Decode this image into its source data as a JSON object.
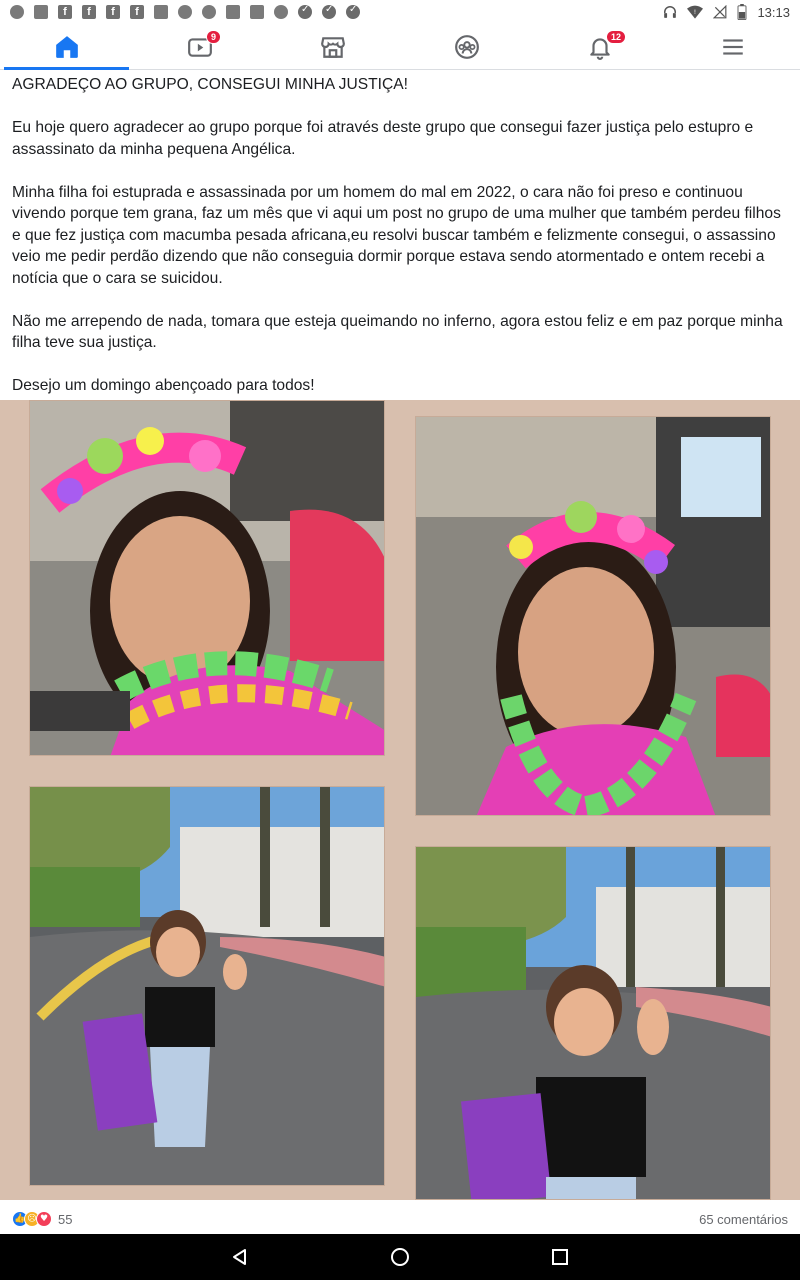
{
  "status_bar": {
    "time": "13:13",
    "left_icons": [
      "whatsapp-business-icon",
      "notification-icon",
      "facebook-icon",
      "facebook-icon",
      "facebook-icon",
      "facebook-icon",
      "instagram-icon",
      "circle-icon",
      "whatsapp-icon",
      "instagram-icon",
      "image-icon",
      "whatsapp-business-icon",
      "check-icon",
      "check-icon",
      "check-icon"
    ],
    "right_icons": [
      "headphones-icon",
      "wifi-icon",
      "no-signal-icon",
      "battery-icon"
    ]
  },
  "nav": {
    "tabs": [
      {
        "name": "home",
        "icon": "home-icon",
        "badge": ""
      },
      {
        "name": "watch",
        "icon": "video-icon",
        "badge": "9"
      },
      {
        "name": "marketplace",
        "icon": "store-icon",
        "badge": ""
      },
      {
        "name": "groups",
        "icon": "groups-icon",
        "badge": ""
      },
      {
        "name": "notifications",
        "icon": "bell-icon",
        "badge": "12"
      },
      {
        "name": "menu",
        "icon": "menu-icon",
        "badge": ""
      }
    ],
    "accent_color": "#1877f2"
  },
  "post": {
    "paragraphs": [
      "AGRADEÇO AO GRUPO, CONSEGUI MINHA JUSTIÇA!",
      "Eu hoje quero agradecer ao grupo porque foi através deste grupo que consegui fazer justiça pelo estupro e assassinato da minha pequena Angélica.",
      "Minha filha foi estuprada e assassinada por um homem do mal em 2022, o cara não foi preso e continuou vivendo porque tem grana, faz um mês que vi aqui um post no grupo de uma mulher que também perdeu filhos e que fez justiça com macumba pesada africana,eu resolvi buscar também e felizmente consegui, o assassino veio me pedir perdão dizendo que não conseguia dormir porque estava sendo atormentado e ontem recebi a notícia que o cara se suicidou.",
      "Não me arrependo de nada, tomara que esteja queimando no inferno, agora estou feliz e em paz porque minha filha teve sua justiça.",
      "Desejo um domingo abençoado para todos!"
    ],
    "photos": [
      {
        "id": "photo-girl-flower-crown-1",
        "subject": "girl with flower crown in car"
      },
      {
        "id": "photo-girl-flower-crown-2",
        "subject": "girl with flower crown in car"
      },
      {
        "id": "photo-toddler-street-1",
        "subject": "toddler waving on street"
      },
      {
        "id": "photo-toddler-street-2",
        "subject": "toddler waving on street"
      }
    ],
    "reaction_count": "55",
    "comments": "65 comentários"
  },
  "system_nav": {
    "icons": [
      "back-icon",
      "home-circle-icon",
      "recents-icon"
    ]
  }
}
